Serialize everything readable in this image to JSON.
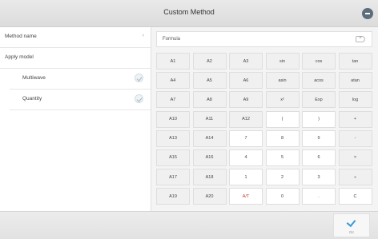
{
  "header": {
    "title": "Custom Method"
  },
  "left_panel": {
    "method_name_label": "Method name",
    "method_name_chevron": "›",
    "apply_model_label": "Apply model",
    "options": [
      {
        "label": "Multiwave",
        "checked": true
      },
      {
        "label": "Quantity",
        "checked": true
      }
    ]
  },
  "formula": {
    "placeholder": "Formula"
  },
  "keypad": {
    "keys": [
      "A1",
      "A2",
      "A3",
      "sin",
      "cos",
      "tan",
      "A4",
      "A5",
      "A6",
      "asin",
      "acos",
      "atan",
      "A7",
      "A8",
      "A9",
      "x²",
      "Exp",
      "log",
      "A10",
      "A11",
      "A12",
      "(",
      ")",
      "+",
      "A13",
      "A14",
      "7",
      "8",
      "9",
      "-",
      "A15",
      "A16",
      "4",
      "5",
      "6",
      "×",
      "A17",
      "A18",
      "1",
      "2",
      "3",
      "÷",
      "A19",
      "A20",
      "A/T",
      "0",
      ".",
      "C"
    ]
  },
  "footer": {
    "ok_label": "OK"
  }
}
